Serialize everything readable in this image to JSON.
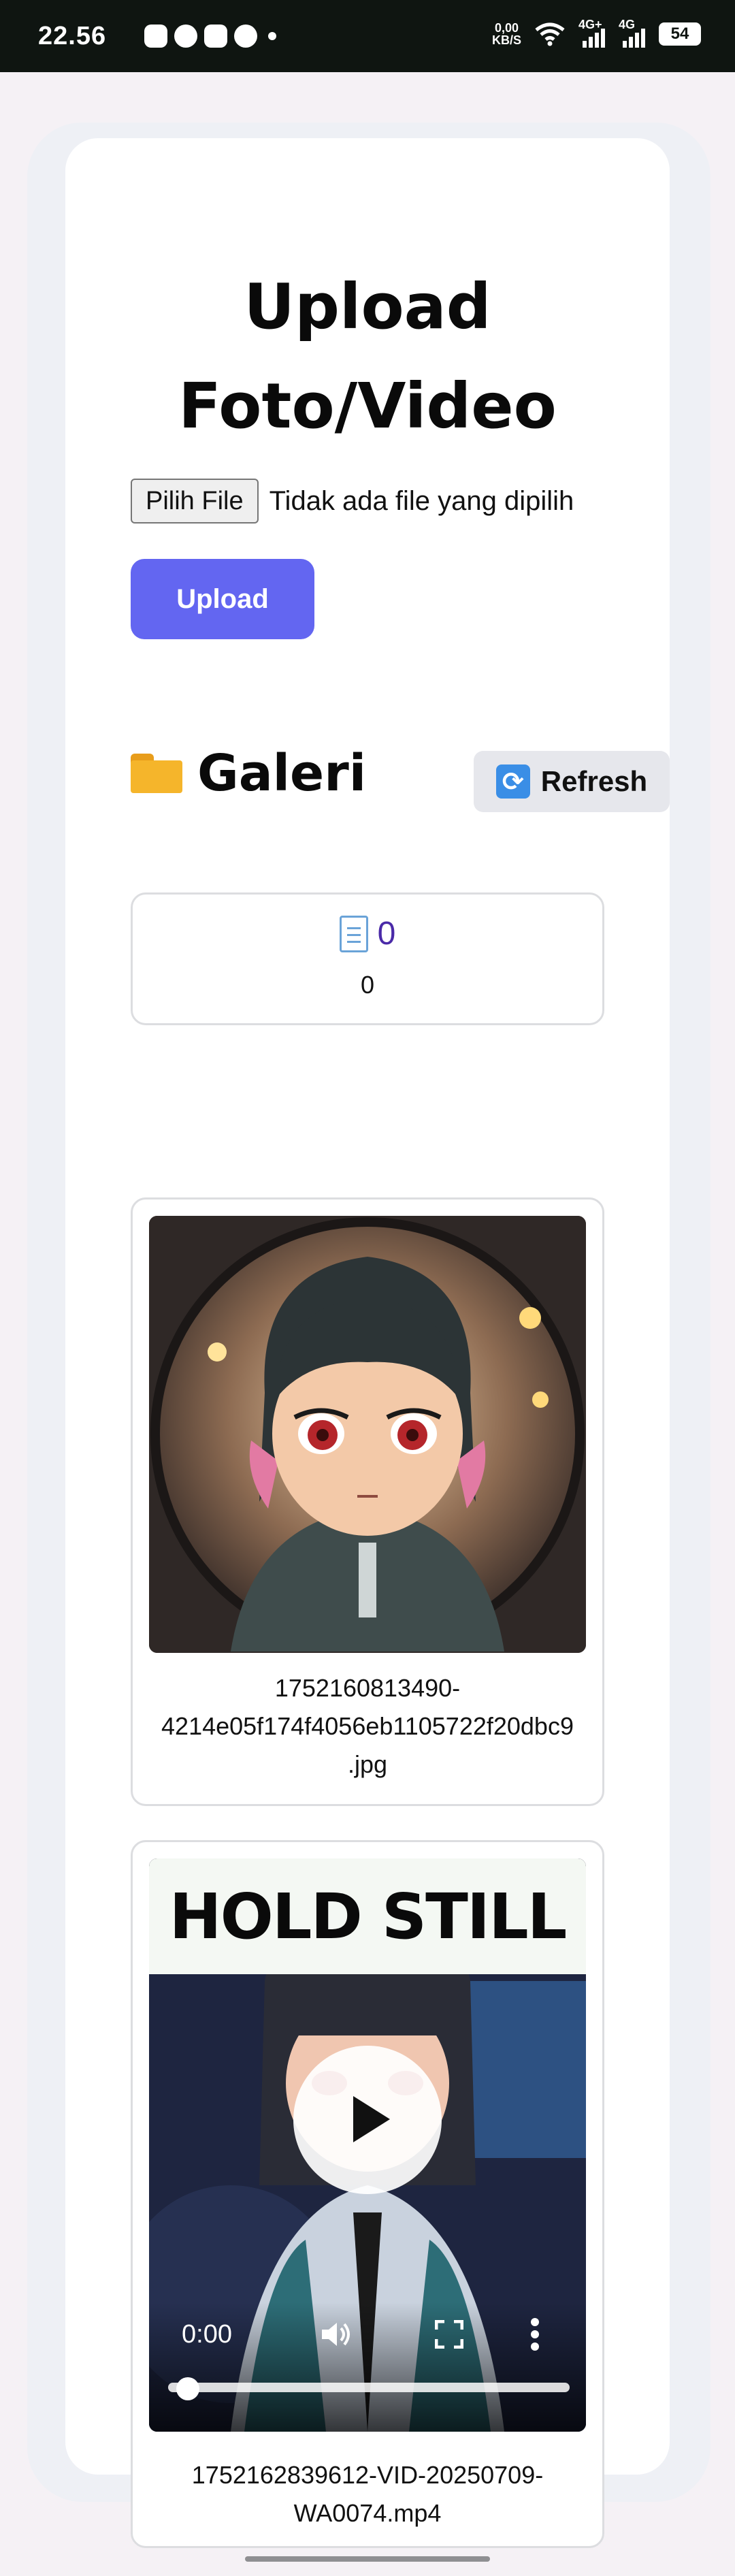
{
  "status_bar": {
    "time": "22.56",
    "net_speed_value": "0,00",
    "net_speed_unit": "KB/S",
    "net1_label": "4G+",
    "net2_label": "4G",
    "battery": "54"
  },
  "page": {
    "title": "Upload Foto/Video",
    "file_input": {
      "button_label": "Pilih File",
      "status": "Tidak ada file yang dipilih"
    },
    "upload_label": "Upload"
  },
  "gallery": {
    "title": "Galeri",
    "refresh_label": "Refresh",
    "items": [
      {
        "type": "document",
        "link_text": "0",
        "name": "0"
      },
      {
        "type": "image",
        "caption_line1": "1752160813490-",
        "caption_line2": "4214e05f174f4056eb1105722f20dbc9",
        "caption_line3": ".jpg"
      },
      {
        "type": "video",
        "overlay_text": "HOLD STILL",
        "time": "0:00",
        "caption_line1": "1752162839612-VID-20250709-",
        "caption_line2": "WA0074.mp4",
        "progress": 0
      }
    ]
  }
}
